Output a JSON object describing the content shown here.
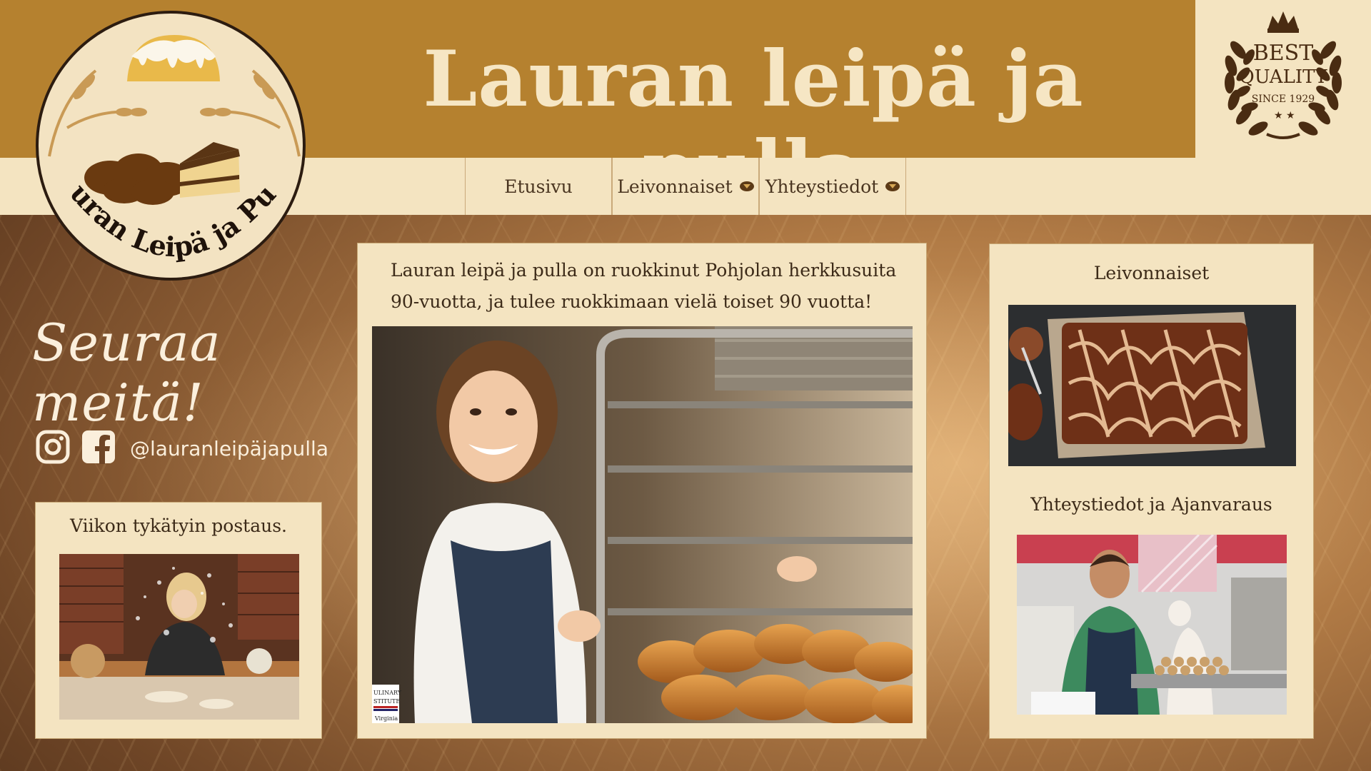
{
  "header": {
    "title": "Lauran leipä ja pulla"
  },
  "logo": {
    "text": "Lauran Leipä ja Pulla"
  },
  "badge": {
    "line1": "BEST",
    "line2": "QUALITY",
    "line3": "SINCE 1929"
  },
  "nav": {
    "items": [
      {
        "label": "Etusivu",
        "has_dropdown": false
      },
      {
        "label": "Leivonnaiset",
        "has_dropdown": true
      },
      {
        "label": "Yhteystiedot",
        "has_dropdown": true
      }
    ]
  },
  "social": {
    "title": "Seuraa meitä!",
    "handle": "@lauranleipäjapulla",
    "icons": [
      "instagram-icon",
      "facebook-icon"
    ]
  },
  "weekly": {
    "title": "Viikon tykätyin postaus."
  },
  "intro": {
    "text": "Lauran leipä ja pulla on ruokkinut Pohjolan herkkusuita 90-vuotta, ja tulee ruokkimaan vielä toiset 90 vuotta!",
    "photo_watermark_line1": "ULINARY",
    "photo_watermark_line2": "STITUTE",
    "photo_watermark_line3": "Virginia"
  },
  "sidebar": {
    "pastries_title": "Leivonnaiset",
    "contact_title": "Yhteystiedot ja Ajanvaraus"
  },
  "colors": {
    "header": "#b5812f",
    "cream": "#f4e4c1",
    "dark_text": "#3c2a18",
    "title_text": "#f6e6c4"
  }
}
